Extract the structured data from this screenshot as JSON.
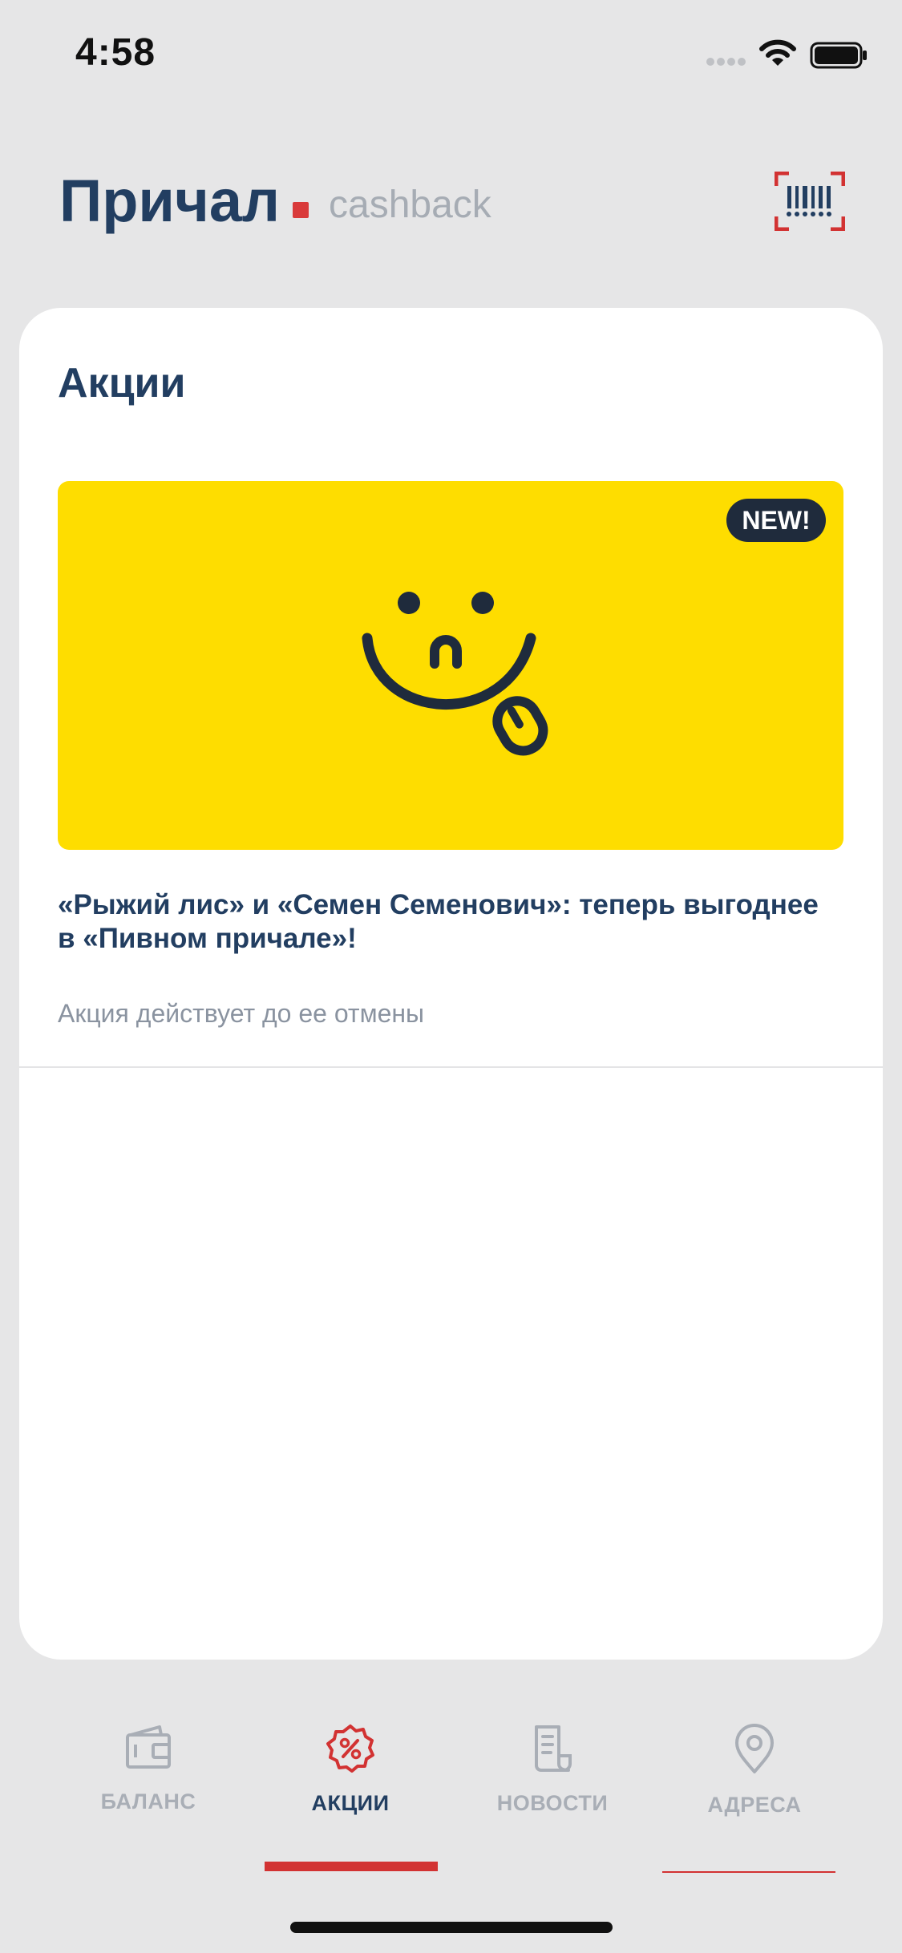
{
  "status_bar": {
    "time": "4:58"
  },
  "header": {
    "brand": "Причал",
    "subtitle": "cashback"
  },
  "section": {
    "title": "Акции"
  },
  "promo": {
    "badge": "NEW!",
    "title": "«Рыжий лис» и «Семен Семенович»: теперь выгоднее в «Пивном причале»!",
    "validity": "Акция действует до ее отмены",
    "image_bg": "#FEDD00"
  },
  "tabs": [
    {
      "label": "БАЛАНС",
      "icon": "wallet-icon",
      "active": false
    },
    {
      "label": "АКЦИИ",
      "icon": "percent-badge-icon",
      "active": true
    },
    {
      "label": "НОВОСТИ",
      "icon": "receipt-icon",
      "active": false
    },
    {
      "label": "АДРЕСА",
      "icon": "location-pin-icon",
      "active": false
    }
  ],
  "colors": {
    "brand": "#223E61",
    "accent": "#D23232",
    "muted": "#A9AEB6"
  }
}
